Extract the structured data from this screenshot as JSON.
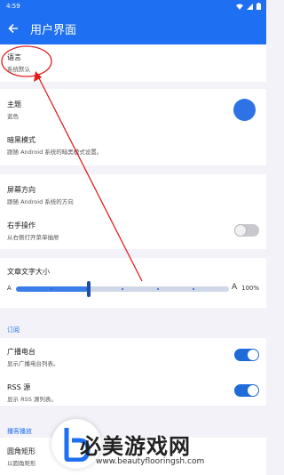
{
  "status": {
    "time": "4:59"
  },
  "header": {
    "title": "用户界面"
  },
  "items": {
    "language": {
      "label": "语言",
      "sub": "系统默认"
    },
    "theme": {
      "label": "主题",
      "sub": "蓝色",
      "color": "#2e72e6"
    },
    "dark_mode": {
      "label": "暗黑模式",
      "sub": "跟随 Android 系统的暗黑模式设置。"
    },
    "orientation": {
      "label": "屏幕方向",
      "sub": "跟随 Android 系统的方向"
    },
    "right_hand": {
      "label": "右手操作",
      "sub": "从右侧打开菜单抽屉",
      "on": false
    },
    "text_size": {
      "label": "文章文字大小",
      "min_label": "A",
      "max_label": "A",
      "value_label": "100%",
      "value_fraction": 0.34,
      "steps": 7
    },
    "radio_broadcast": {
      "label": "广播电台",
      "sub": "显示广播电台列表。",
      "on": true
    },
    "rss": {
      "label": "RSS 源",
      "sub": "显示 RSS 源列表。",
      "on": true
    },
    "rounded": {
      "label": "圆角矩形",
      "sub": "以圆角矩形"
    }
  },
  "sections": {
    "subscription": "订阅",
    "player": "播客播放"
  },
  "watermark": {
    "text": "必美游戏网",
    "url": "www.beautyflooringsh.com"
  },
  "colors": {
    "primary": "#1e6ff1",
    "annotation": "#e02020"
  }
}
